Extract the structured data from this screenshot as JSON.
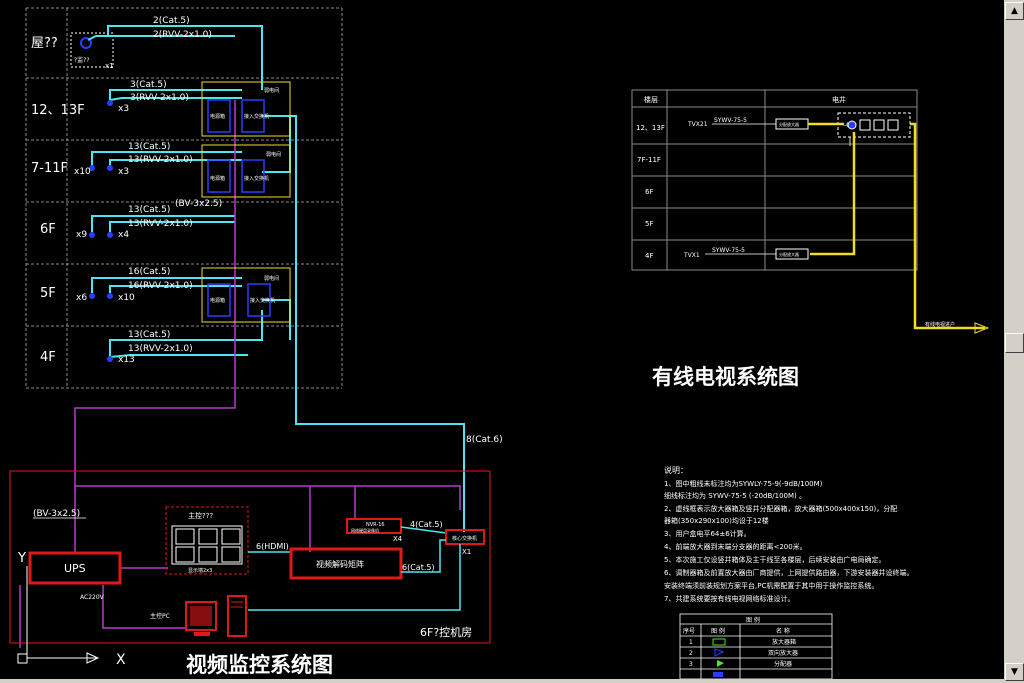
{
  "floor_labels": [
    "屋??",
    "12、13F",
    "7-11F",
    "6F",
    "5F",
    "4F"
  ],
  "roof_device": "?监??",
  "cable_labels": {
    "roof_cat": "2(Cat.5)",
    "roof_rvv": "2(RVV-2x1.0)",
    "roof_count": "x1",
    "f12_cat": "3(Cat.5)",
    "f12_rvv": "3(RVV-2x1.0)",
    "f12_count": "x3",
    "f7_cat": "13(Cat.5)",
    "f7_rvv": "13(RVV-2x1.0)",
    "f7_count_a": "x10",
    "f7_count_b": "x3",
    "f6_bv": "(BV-3x2.5)",
    "f6_cat": "13(Cat.5)",
    "f6_rvv": "13(RVV-2x1.0)",
    "f6_count_a": "x9",
    "f6_count_b": "x4",
    "f5_cat": "16(Cat.5)",
    "f5_rvv": "16(RVV-2x1.0)",
    "f5_count_a": "x6",
    "f5_count_b": "x10",
    "f4_cat": "13(Cat.5)",
    "f4_rvv": "13(RVV-2x1.0)",
    "f4_count": "x13",
    "trunk_cat": "8(Cat.6)"
  },
  "switch_boxes": {
    "f12_a": "电源箱",
    "f12_b": "接入交换机",
    "f12_c": "弱电间",
    "f7_a": "电源箱",
    "f7_b": "接入交换机",
    "f7_c": "弱电间",
    "f5_a": "电源箱",
    "f5_b": "接入交换机",
    "f5_c": "弱电间"
  },
  "control_room": {
    "bv_label": "(BV-3x2.5)",
    "ups": "UPS",
    "ac_label": "AC220V",
    "monitor_wall_title": "主控???",
    "monitor_wall_sub": "显示墙2x3",
    "hdmi_label": "6(HDMI)",
    "matrix": "视频解码矩阵",
    "nvr": "NVR-16",
    "nvr_sub": "网络硬盘录像机",
    "nvr_count": "X4",
    "nvr_cat": "4(Cat.5)",
    "core_switch": "核心交换机",
    "core_count": "X1",
    "matrix_cat": "6(Cat.5)",
    "pc_label": "主控PC",
    "room_label": "6F?控机房"
  },
  "cctv_title": "视频监控系统图",
  "tv_title": "有线电视系统图",
  "tv_table": {
    "col_floor": "楼层",
    "col_shaft": "电井",
    "floors": [
      "12、13F",
      "7F-11F",
      "6F",
      "5F",
      "4F"
    ],
    "tvx2": "TVX21",
    "cable_top": "SYWV-75-5",
    "amp_top": "分配放大器",
    "tvx1": "TVX1",
    "cable_bot": "SYWV-75-5",
    "amp_bot": "分配放大器",
    "splitter": "-4",
    "incoming": "有线电视进户"
  },
  "notes": {
    "title": "说明：",
    "lines": [
      "1、图中粗线未标注均为SYWLY-75-9(-9dB/100M)",
      "细线标注均为 SYWV-75-5 (-20dB/100M) 。",
      "2、虚线框表示放大器箱及竖井分配器箱，放大器箱(500x400x150)，分配",
      "器箱(350x290x100)均设于12楼",
      "3、用户盒电平64±6计算。",
      "4、前端放大器到末端分支器的距离<200米。",
      "5、本次施工仅设竖井箱体及主干线至各楼层，后续安装由广电局确定。",
      "6、调制器箱及前置放大器由厂商提供，上网提供路由器，下游安装器并设终端。",
      "   安装终端须前装规划方案平台,PC机需配置于其中用于操作监控系统。",
      "7、共建系统要按有线电视网络标准设计。"
    ]
  },
  "legend": {
    "title": "图 例",
    "headers": [
      "序号",
      "图 例",
      "名 称"
    ],
    "rows": [
      {
        "no": "1",
        "name": "放大器箱"
      },
      {
        "no": "2",
        "name": "双向放大器"
      },
      {
        "no": "3",
        "name": "分配器"
      }
    ]
  },
  "axis": {
    "y": "Y",
    "x": "X"
  },
  "scrollbar": {
    "up": "▲",
    "down": "▼"
  },
  "colors": {
    "cyan": "#4de6f0",
    "magenta": "#b43cc8",
    "red": "#e01818",
    "yellow": "#f0dc28",
    "blue": "#2a3cff",
    "grid": "#8a8a8a"
  }
}
